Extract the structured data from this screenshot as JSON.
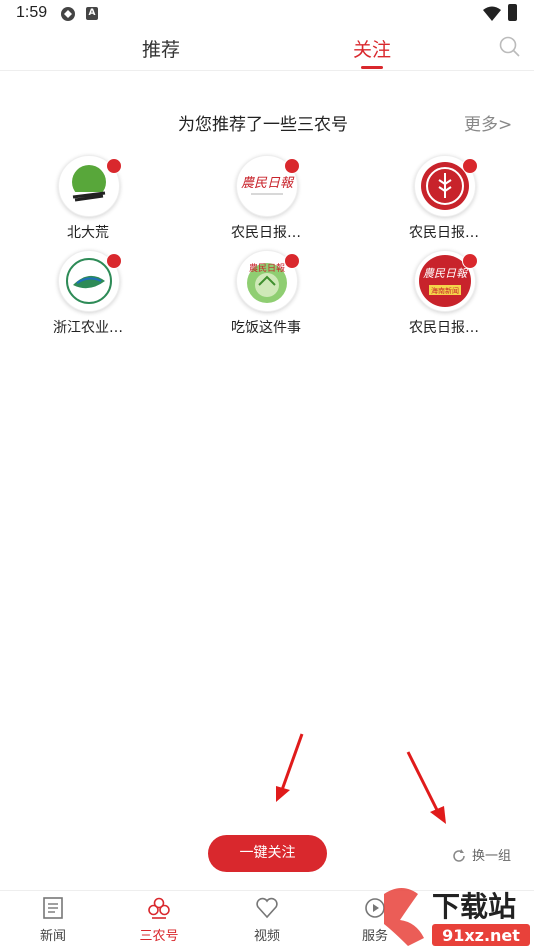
{
  "status": {
    "time": "1:59"
  },
  "tabs": {
    "recommend": "推荐",
    "follow": "关注"
  },
  "section": {
    "title": "为您推荐了一些三农号",
    "more": "更多>"
  },
  "accounts": [
    {
      "name": "北大荒"
    },
    {
      "name": "农民日报…"
    },
    {
      "name": "农民日报…"
    },
    {
      "name": "浙江农业…"
    },
    {
      "name": "吃饭这件事"
    },
    {
      "name": "农民日报…"
    }
  ],
  "actions": {
    "follow_all": "一键关注",
    "refresh": "换一组"
  },
  "nav": [
    {
      "label": "新闻",
      "icon": "newspaper-icon"
    },
    {
      "label": "三农号",
      "icon": "clover-icon"
    },
    {
      "label": "视频",
      "icon": "heart-icon"
    },
    {
      "label": "服务",
      "icon": "service-icon"
    }
  ],
  "watermark": {
    "text": "下载站",
    "url_text": "91xz.net"
  },
  "colors": {
    "accent": "#d9282d",
    "arrow": "#e01b1b"
  }
}
